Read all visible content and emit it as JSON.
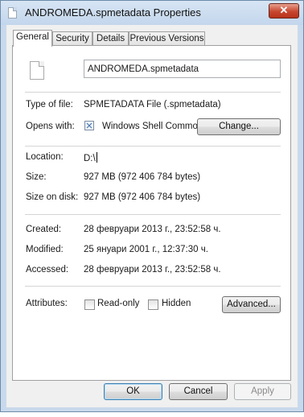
{
  "window": {
    "title": "ANDROMEDA.spmetadata Properties",
    "close_label": "✕"
  },
  "tabs": [
    "General",
    "Security",
    "Details",
    "Previous Versions"
  ],
  "general": {
    "filename": "ANDROMEDA.spmetadata",
    "type_label": "Type of file:",
    "type_value": "SPMETADATA File (.spmetadata)",
    "opens_label": "Opens with:",
    "opens_value": "Windows Shell Commor",
    "change_button": "Change...",
    "location_label": "Location:",
    "location_value": "D:\\",
    "size_label": "Size:",
    "size_value": "927 MB (972 406 784 bytes)",
    "size_on_disk_label": "Size on disk:",
    "size_on_disk_value": "927 MB (972 406 784 bytes)",
    "created_label": "Created:",
    "created_value": "28 февруари 2013 г., 23:52:58 ч.",
    "modified_label": "Modified:",
    "modified_value": "25 януари 2001 г., 12:37:30 ч.",
    "accessed_label": "Accessed:",
    "accessed_value": "28 февруари 2013 г., 23:52:58 ч.",
    "attributes_label": "Attributes:",
    "readonly_label": "Read-only",
    "readonly_checked": false,
    "hidden_label": "Hidden",
    "hidden_checked": false,
    "advanced_button": "Advanced..."
  },
  "footer": {
    "ok": "OK",
    "cancel": "Cancel",
    "apply": "Apply"
  },
  "colors": {
    "frame": "#c9d9ec",
    "close": "#c7462e",
    "panel": "#ffffff"
  }
}
